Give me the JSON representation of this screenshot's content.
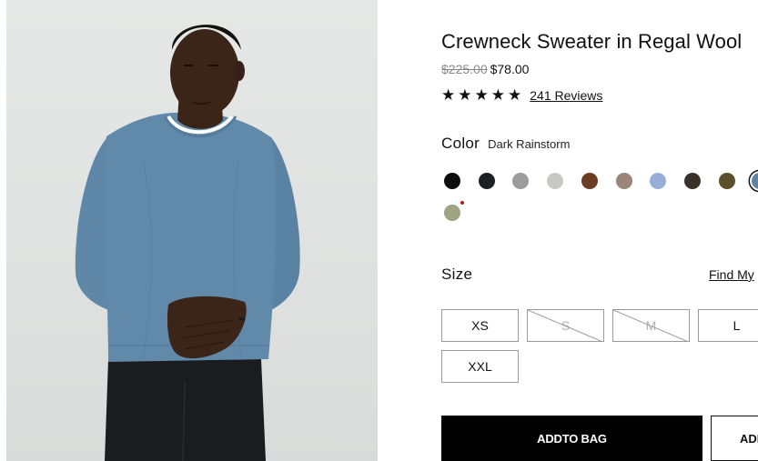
{
  "product": {
    "title": "Crewneck Sweater in Regal Wool",
    "price_original": "$225.00",
    "price_sale": "$78.00",
    "rating_stars": 5,
    "reviews_link": "241 Reviews"
  },
  "color": {
    "label": "Color",
    "selected_name": "Dark Rainstorm",
    "swatches": [
      {
        "hex": "#0d0d0d"
      },
      {
        "hex": "#1c2024"
      },
      {
        "hex": "#9c9c9c"
      },
      {
        "hex": "#c9c9c4"
      },
      {
        "hex": "#6b3c22"
      },
      {
        "hex": "#9b8579"
      },
      {
        "hex": "#97aed8"
      },
      {
        "hex": "#3a312b"
      },
      {
        "hex": "#5b5029"
      },
      {
        "hex": "#5f84a3",
        "selected": true
      },
      {
        "hex": "#9fa383",
        "is_new": true
      }
    ],
    "new_dot_color": "#b01c1c"
  },
  "size": {
    "label": "Size",
    "find_link": "Find My",
    "options": [
      {
        "label": "XS",
        "available": true
      },
      {
        "label": "S",
        "available": false
      },
      {
        "label": "M",
        "available": false
      },
      {
        "label": "L",
        "available": true
      },
      {
        "label": "XXL",
        "available": true
      }
    ]
  },
  "actions": {
    "add_to_bag": "ADDTO BAG",
    "second_button": "ADI"
  },
  "image": {
    "subject": "model-wearing-blue-crewneck-sweater",
    "sweater_color": "#5f87a8",
    "background_color": "#e3e5e4"
  }
}
